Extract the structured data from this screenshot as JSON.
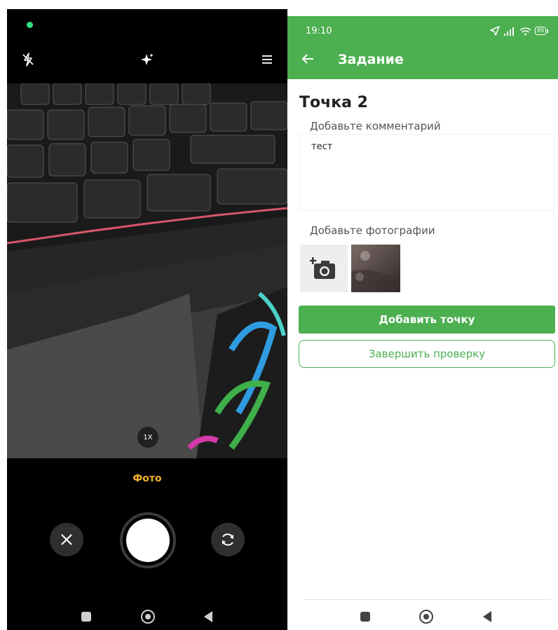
{
  "camera": {
    "icons": {
      "flash": "flash-off-icon",
      "beauty": "sparkle-icon",
      "menu": "menu-icon",
      "cancel": "close-icon",
      "switch": "switch-camera-icon"
    },
    "zoom": "1X",
    "mode": "Фото",
    "colors": {
      "mode_accent": "#f0b030",
      "status_dot": "#2ee07a"
    }
  },
  "app": {
    "status_time": "19:10",
    "battery": "89",
    "title": "Задание",
    "point_title": "Точка 2",
    "comment_label": "Добавьте комментарий",
    "comment_value": "тест",
    "photos_label": "Добавьте фотографии",
    "add_point_button": "Добавить точку",
    "finish_button": "Завершить проверку",
    "colors": {
      "primary": "#4caf50"
    }
  }
}
